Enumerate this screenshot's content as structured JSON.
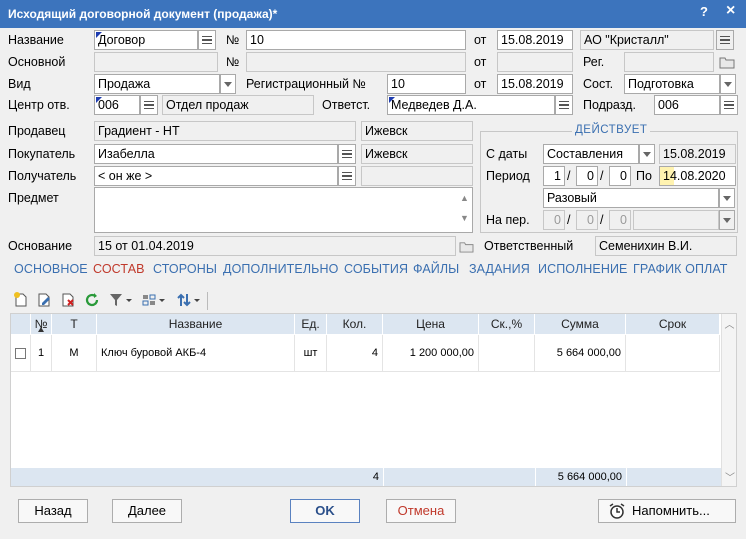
{
  "window": {
    "title": "Исходящий договорной документ (продажа)*",
    "help_label": "?",
    "close_label": "×"
  },
  "form": {
    "name_label": "Название",
    "name_value": "Договор",
    "num_label": "№",
    "num_value": "10",
    "from_label": "от",
    "date_value": "15.08.2019",
    "org_value": "АО \"Кристалл\"",
    "basic_label": "Основной",
    "basic_num_label": "№",
    "basic_from_label": "от",
    "reg_label": "Рег.",
    "kind_label": "Вид",
    "kind_value": "Продажа",
    "regnum_label": "Регистрационный №",
    "regnum_value": "10",
    "regfrom_label": "от",
    "regdate_value": "15.08.2019",
    "state_label": "Сост.",
    "state_value": "Подготовка",
    "center_label": "Центр отв.",
    "center_code": "006",
    "center_name": "Отдел продаж",
    "resp_label": "Ответст.",
    "resp_value": "Медведев Д.А.",
    "dept_label": "Подразд.",
    "dept_value": "006",
    "seller_label": "Продавец",
    "seller_value": "Градиент - НТ",
    "seller_city": "Ижевск",
    "buyer_label": "Покупатель",
    "buyer_value": "Изабелла",
    "buyer_city": "Ижевск",
    "recipient_label": "Получатель",
    "recipient_value": "< он же >",
    "subject_label": "Предмет",
    "basis_label": "Основание",
    "basis_value": "15 от 01.04.2019",
    "responsible_label": "Ответственный",
    "responsible_value": "Семенихин В.И."
  },
  "validity": {
    "legend": "ДЕЙСТВУЕТ",
    "from_label": "С даты",
    "from_mode": "Составления",
    "from_date": "15.08.2019",
    "period_label": "Период",
    "period_y": "1",
    "period_m": "0",
    "period_d": "0",
    "slash": "/",
    "to_label": "По",
    "to_date": "14.08.2020",
    "kind_value": "Разовый",
    "per_label": "На пер.",
    "per_y": "0",
    "per_m": "0",
    "per_d": "0"
  },
  "tabs": [
    "ОСНОВНОЕ",
    "СОСТАВ",
    "СТОРОНЫ",
    "ДОПОЛНИТЕЛЬНО",
    "СОБЫТИЯ",
    "ФАЙЛЫ",
    "ЗАДАНИЯ",
    "ИСПОЛНЕНИЕ",
    "ГРАФИК ОПЛАТ"
  ],
  "active_tab": "СОСТАВ",
  "table": {
    "headers": [
      "№",
      "Т",
      "Название",
      "Ед.",
      "Кол.",
      "Цена",
      "Ск.,%",
      "Сумма",
      "Срок"
    ],
    "rows": [
      {
        "num": "1",
        "type": "М",
        "name": "Ключ буровой АКБ-4",
        "unit": "шт",
        "qty": "4",
        "price": "1 200 000,00",
        "discount": "",
        "sum": "5 664 000,00",
        "term": ""
      }
    ],
    "footer_qty": "4",
    "footer_sum": "5 664 000,00"
  },
  "buttons": {
    "back": "Назад",
    "next": "Далее",
    "ok": "OK",
    "cancel": "Отмена",
    "remind": "Напомнить..."
  },
  "colors": {
    "titlebar": "#3c74bd",
    "tab": "#3a6fb0",
    "active_tab": "#c0392b",
    "grid_header": "#dce6f1",
    "today_highlight": "#fff3b0"
  }
}
